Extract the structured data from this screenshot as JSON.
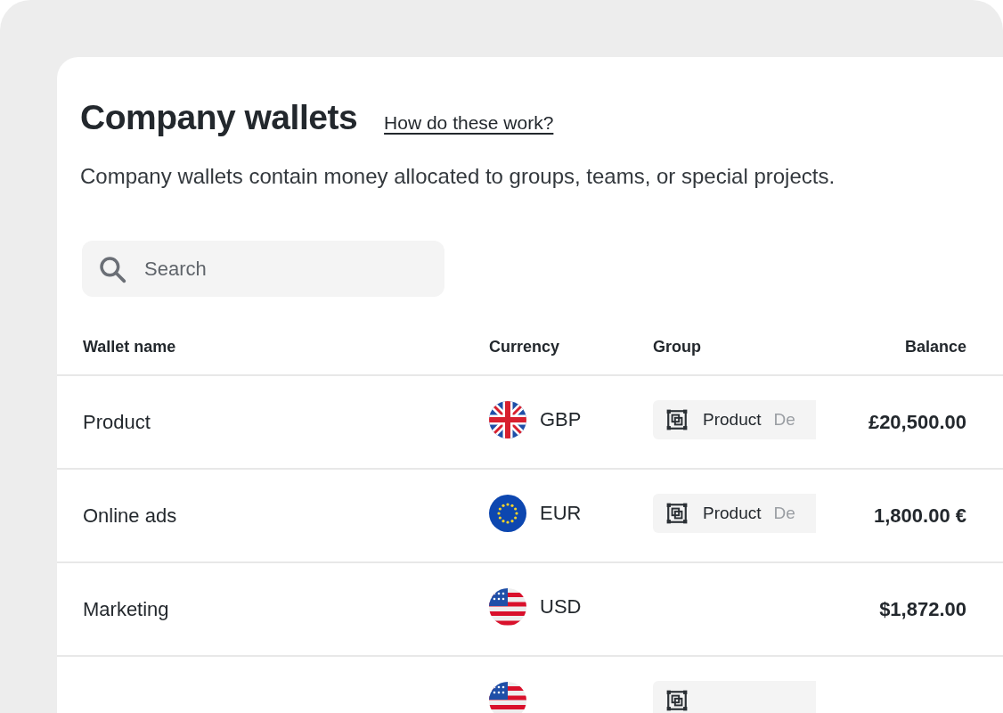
{
  "title": "Company wallets",
  "help_link": "How do these work?",
  "description": "Company wallets contain money allocated to groups, teams, or special projects.",
  "search": {
    "placeholder": "Search"
  },
  "table": {
    "columns": [
      "Wallet name",
      "Currency",
      "Group",
      "Balance"
    ],
    "rows": [
      {
        "name": "Product",
        "currency": "GBP",
        "flag": {
          "kind": "gb"
        },
        "group": {
          "name": "Product",
          "detail": "De"
        },
        "balance": "£20,500.00"
      },
      {
        "name": "Online ads",
        "currency": "EUR",
        "flag": {
          "kind": "eu"
        },
        "group": {
          "name": "Product",
          "detail": "De"
        },
        "balance": "1,800.00 €"
      },
      {
        "name": "Marketing",
        "currency": "USD",
        "flag": {
          "kind": "us"
        },
        "balance": "$1,872.00"
      },
      {
        "flag": {
          "kind": "us"
        },
        "group": {}
      }
    ]
  }
}
